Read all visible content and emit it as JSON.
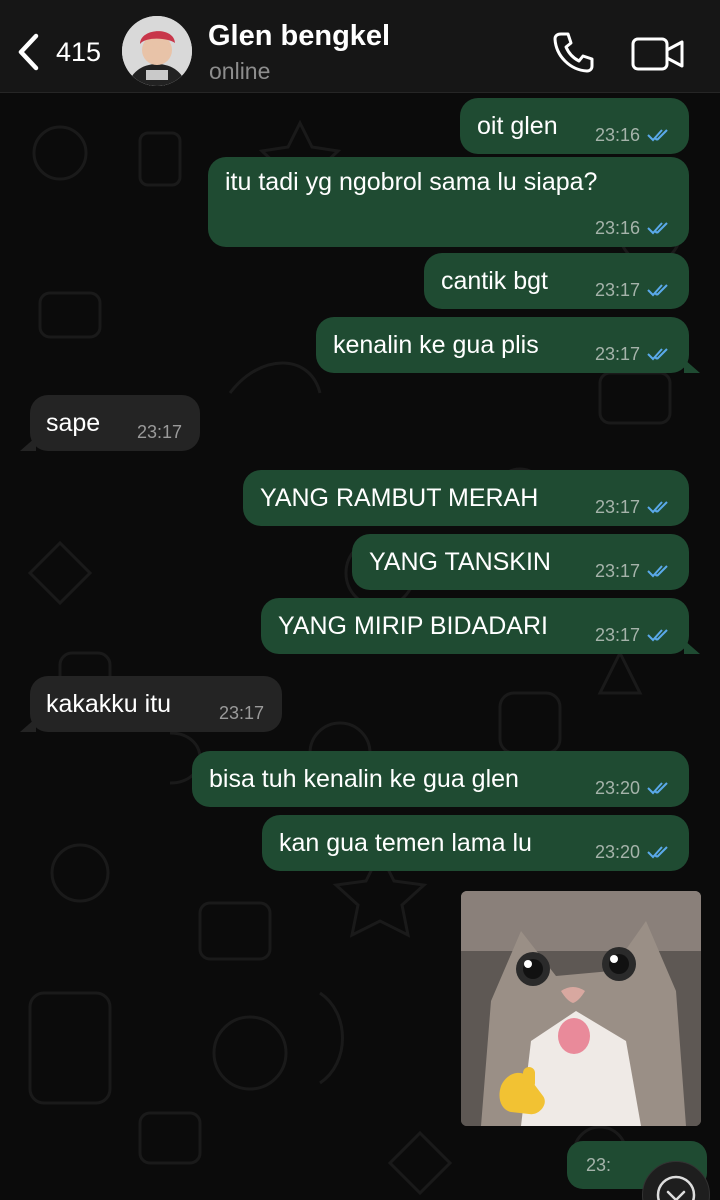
{
  "header": {
    "back_count": "415",
    "contact_name": "Glen bengkel",
    "status": "online"
  },
  "messages": [
    {
      "text": "oit glen",
      "time": "23:16",
      "from": "me",
      "read": true
    },
    {
      "text": "itu tadi yg ngobrol sama lu siapa?",
      "time": "23:16",
      "from": "me",
      "read": true
    },
    {
      "text": "cantik bgt",
      "time": "23:17",
      "from": "me",
      "read": true
    },
    {
      "text": "kenalin ke gua plis",
      "time": "23:17",
      "from": "me",
      "read": true
    },
    {
      "text": "sape",
      "time": "23:17",
      "from": "contact"
    },
    {
      "text": "YANG RAMBUT MERAH",
      "time": "23:17",
      "from": "me",
      "read": true
    },
    {
      "text": "YANG TANSKIN",
      "time": "23:17",
      "from": "me",
      "read": true
    },
    {
      "text": "YANG MIRIP BIDADARI",
      "time": "23:17",
      "from": "me",
      "read": true
    },
    {
      "text": "kakakku itu",
      "time": "23:17",
      "from": "contact"
    },
    {
      "text": "bisa tuh kenalin ke gua glen",
      "time": "23:20",
      "from": "me",
      "read": true
    },
    {
      "text": "kan gua temen lama lu",
      "time": "23:20",
      "from": "me",
      "read": true
    }
  ],
  "sticker": {
    "description_icon": "cat-sticker-photo"
  },
  "partial_message": {
    "time": "23:"
  },
  "colors": {
    "outgoing_bubble": "#1f4b32",
    "incoming_bubble": "#242424",
    "read_tick": "#5aa9ea",
    "background": "#0b0b0b"
  }
}
